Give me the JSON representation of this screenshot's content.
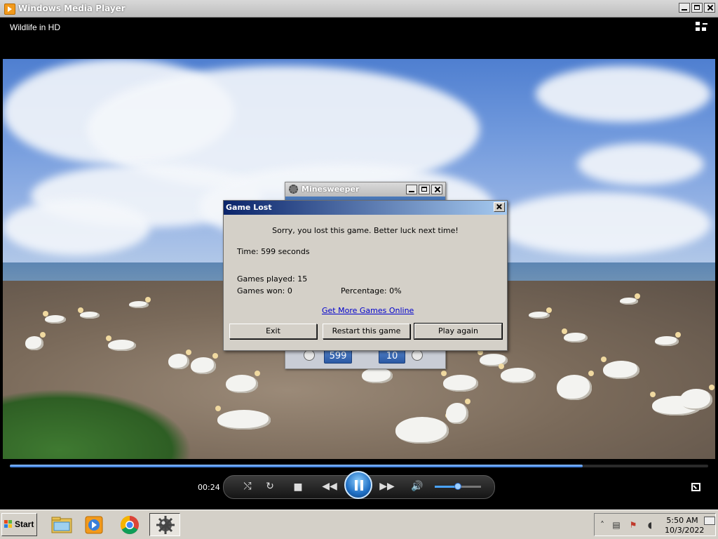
{
  "wmp": {
    "window_title": "Windows Media Player",
    "now_playing": "Wildlife in HD",
    "elapsed_time": "00:24",
    "seek_progress": 0.82,
    "volume_level": 0.5
  },
  "minesweeper": {
    "window_title": "Minesweeper",
    "time_counter": "599",
    "mines_counter": "10"
  },
  "dialog": {
    "title": "Game Lost",
    "message": "Sorry, you lost this game. Better luck next time!",
    "time_label": "Time: 599 seconds",
    "games_played": "Games played: 15",
    "games_won": "Games won: 0",
    "percentage": "Percentage: 0%",
    "link_label": "Get More Games Online",
    "buttons": {
      "exit": "Exit",
      "restart": "Restart this game",
      "play_again": "Play again"
    }
  },
  "taskbar": {
    "start_label": "Start",
    "items": [
      "file-explorer-icon",
      "media-player-icon",
      "chrome-icon",
      "minesweeper-icon"
    ],
    "clock_time": "5:50 AM",
    "clock_date": "10/3/2022"
  },
  "colors": {
    "dialog_title_start": "#0a246a",
    "dialog_title_end": "#a6caf0",
    "seek_fill": "#2d6fd1",
    "link": "#0000cc"
  }
}
